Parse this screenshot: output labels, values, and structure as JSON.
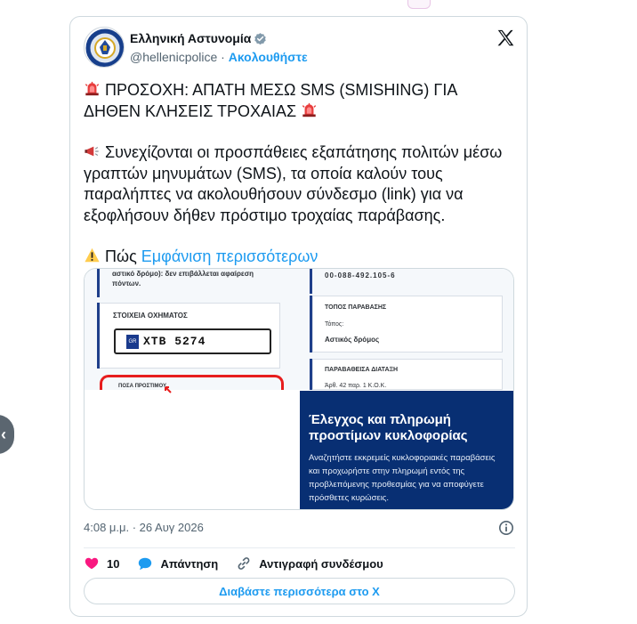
{
  "tweet": {
    "author_name": "Ελληνική Αστυνομία",
    "handle": "@hellenicpolice",
    "separator": "·",
    "follow_label": "Ακολουθήστε",
    "line1": "ΠΡΟΣΟΧΗ: ΑΠΑΤΗ ΜΕΣΩ SMS (SMISHING) ΓΙΑ ΔΗΘΕΝ ΚΛΗΣΕΙΣ ΤΡΟΧΑΙΑΣ",
    "line2": "Συνεχίζονται οι προσπάθειες εξαπάτησης πολιτών μέσω γραπτών μηνυμάτων (SMS), τα οποία καλούν τους παραλήπτες να ακολουθήσουν σύνδεσμο (link) για να εξοφλήσουν δήθεν πρόστιμο τροχαίας παράβασης.",
    "line3_prefix": "Πώς",
    "show_more": "Εμφάνιση περισσότερων",
    "timestamp": "4:08 μ.μ. · 26 Αυγ 2026",
    "likes": "10",
    "reply_label": "Απάντηση",
    "copy_link_label": "Αντιγραφή συνδέσμου",
    "read_more_label": "Διαβάστε περισσότερα στο X"
  },
  "media": {
    "left_note": "αστικό δρόμο): δεν επιβάλλεται αφαίρεση πόντων.",
    "vehicle_heading": "ΣΤΟΙΧΕΙΑ ΟΧΗΜΑΤΟΣ",
    "country_code": "GR",
    "plate": "ΧΤΒ 5274",
    "fine_heading": "ΠΟΣΑ ΠΡΟΣΤΙΜΟΥ",
    "reference": "00-088-492.105-6",
    "place_heading": "ΤΟΠΟΣ ΠΑΡΑΒΑΣΗΣ",
    "place_label": "Τόπος:",
    "place_value": "Αστικός δρόμος",
    "violation_heading": "ΠΑΡΑΒΑΘΕΙΣΑ ΔΙΑΤΑΞΗ",
    "violation_value": "Άρθ. 42 παρ. 1 Κ.Ο.Κ.",
    "card_title": "Έλεγχος και πληρωμή προστίμων κυκλοφορίας",
    "card_description": "Αναζητήστε εκκρεμείς κυκλοφοριακές παραβάσεις και προχωρήστε στην πληρωμή εντός της προβλεπόμενης προθεσμίας για να αποφύγετε πρόσθετες κυρώσεις."
  },
  "colors": {
    "link_blue": "#1d9bf0",
    "card_navy": "#082f73",
    "like_red": "#f91880"
  }
}
